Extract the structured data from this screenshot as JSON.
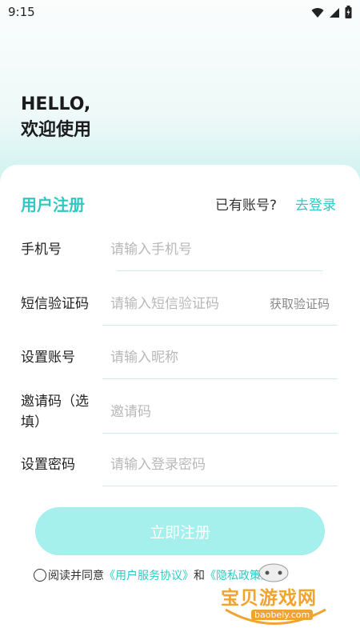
{
  "status": {
    "time": "9:15"
  },
  "greeting": {
    "line1": "HELLO,",
    "line2": "欢迎使用"
  },
  "form": {
    "title": "用户注册",
    "have_account": "已有账号?",
    "login_link": "去登录",
    "fields": [
      {
        "label": "手机号",
        "placeholder": "请输入手机号",
        "value": ""
      },
      {
        "label": "短信验证码",
        "placeholder": "请输入短信验证码",
        "value": "",
        "action": "获取验证码"
      },
      {
        "label": "设置账号",
        "placeholder": "请输入昵称",
        "value": ""
      },
      {
        "label": "邀请码（选\n填）",
        "placeholder": "邀请码",
        "value": ""
      },
      {
        "label": "设置密码",
        "placeholder": "请输入登录密码",
        "value": ""
      }
    ],
    "submit_label": "立即注册",
    "agreement": {
      "prefix": "阅读并同意",
      "user_agreement": "《用户服务协议》",
      "and": "和",
      "privacy_policy": "《隐私政策》"
    }
  },
  "watermark": {
    "text": "宝贝游戏网",
    "sub": "baobeiy.com"
  },
  "colors": {
    "accent": "#2fc9c4",
    "button": "#a5efed",
    "background_top": "#fbfdfd",
    "background_bottom": "#bff0ec"
  }
}
